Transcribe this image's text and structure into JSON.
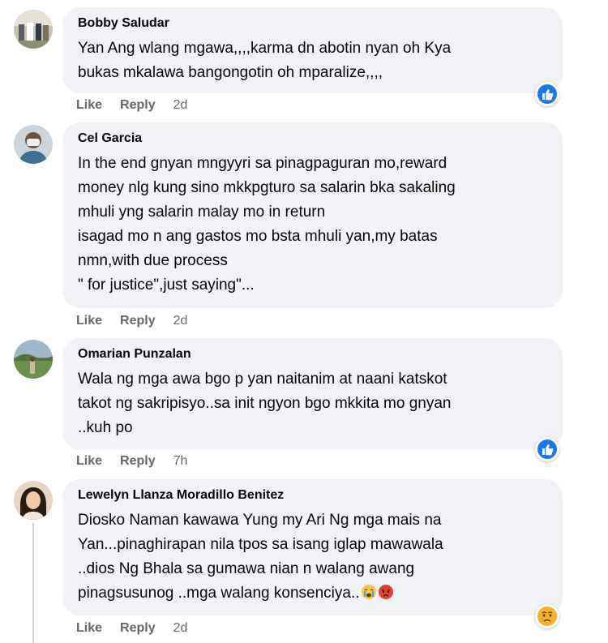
{
  "comments": [
    {
      "author": "Bobby Saludar",
      "lines": [
        "Yan Ang wlang mgawa,,,,karma dn abotin nyan oh Kya",
        "bukas mkalawa bangongotin oh mparalize,,,,"
      ],
      "actions": {
        "like": "Like",
        "reply": "Reply",
        "time": "2d"
      },
      "reaction": "like-reaction-icon"
    },
    {
      "author": "Cel Garcia",
      "lines": [
        "In the end gnyan mngyyri sa pinagpaguran mo,reward",
        "money nlg kung sino mkkpgturo sa salarin bka sakaling",
        "mhuli yng salarin malay mo in return",
        "isagad mo n ang gastos mo bsta mhuli yan,my batas",
        "nmn,with due process",
        "\" for justice\",just saying\"..."
      ],
      "actions": {
        "like": "Like",
        "reply": "Reply",
        "time": "2d"
      },
      "reaction": ""
    },
    {
      "author": "Omarian Punzalan",
      "lines": [
        "Wala ng mga awa bgo p yan naitanim at naani katskot",
        "takot ng sakripisyo..sa init ngyon bgo mkkita mo gnyan",
        "..kuh po"
      ],
      "actions": {
        "like": "Like",
        "reply": "Reply",
        "time": "7h"
      },
      "reaction": "like-reaction-icon"
    },
    {
      "author": "Lewelyn Llanza Moradillo Benitez",
      "lines": [
        "Diosko Naman kawawa Yung my Ari Ng mga mais na",
        "Yan...pinaghirapan nila tpos sa isang iglap mawawala",
        "..dios Ng Bhala sa gumawa nian n walang awang",
        "pinagsusunog ..mga walang konsenciya.."
      ],
      "trailing_emojis": [
        "crying-face-emoji",
        "angry-face-emoji"
      ],
      "actions": {
        "like": "Like",
        "reply": "Reply",
        "time": "2d"
      },
      "reaction": "sad-reaction-icon"
    }
  ],
  "colors": {
    "bubble": "#f0f2f5",
    "meta_text": "#65676b",
    "like_blue": "#1877f2",
    "sad_yellow": "#f7b125"
  }
}
